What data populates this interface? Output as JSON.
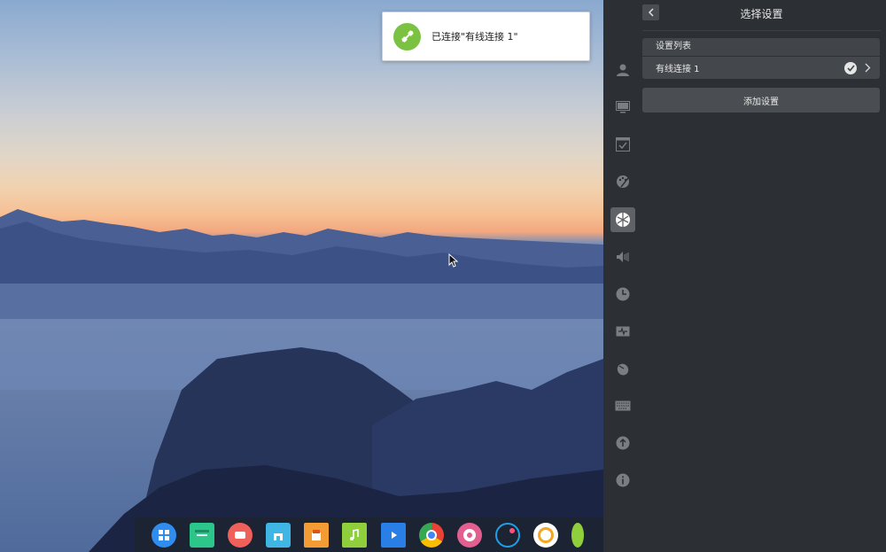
{
  "notification": {
    "message": "已连接\"有线连接 1\"",
    "accent_color": "#7cc242",
    "icon": "network-plug-icon"
  },
  "settings_panel": {
    "title": "选择设置",
    "back_icon": "chevron-left-icon",
    "list_header": "设置列表",
    "connections": [
      {
        "label": "有线连接 1",
        "selected": true
      }
    ],
    "add_button_label": "添加设置",
    "sidebar_icons": [
      "user-icon",
      "display-icon",
      "default-apps-icon",
      "personalization-icon",
      "network-icon",
      "sound-icon",
      "time-icon",
      "power-icon",
      "mouse-icon",
      "keyboard-icon",
      "update-icon",
      "info-icon"
    ],
    "active_sidebar_index": 4
  },
  "dock": {
    "apps": [
      "launcher-icon",
      "file-manager-icon",
      "screen-recorder-icon",
      "store-icon",
      "app-store-icon",
      "music-player-icon",
      "video-player-icon",
      "chrome-icon",
      "control-center-icon",
      "system-monitor-icon",
      "camera-icon",
      "more-icon"
    ]
  },
  "colors": {
    "panel_bg": "#2c2f33",
    "row_bg": "#44474b",
    "active_nav_bg": "#5f6266"
  }
}
